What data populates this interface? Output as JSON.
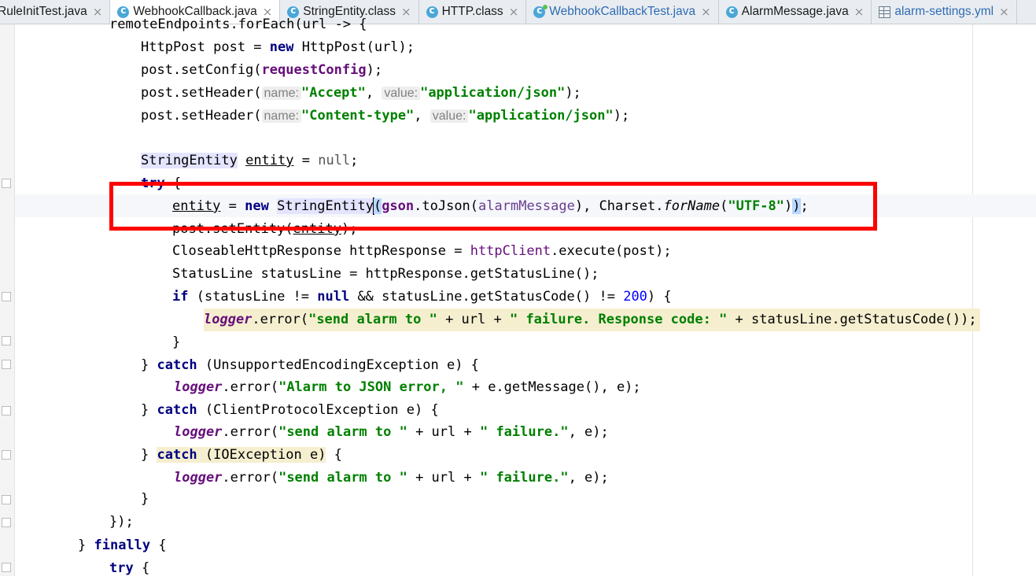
{
  "tabs": [
    {
      "label": "RuleInitTest.java",
      "icon": "java-class-icon"
    },
    {
      "label": "WebhookCallback.java",
      "icon": "java-class-icon",
      "active": true
    },
    {
      "label": "StringEntity.class",
      "icon": "compiled-class-icon"
    },
    {
      "label": "HTTP.class",
      "icon": "compiled-class-icon"
    },
    {
      "label": "WebhookCallbackTest.java",
      "icon": "java-test-class-icon"
    },
    {
      "label": "AlarmMessage.java",
      "icon": "java-class-icon"
    },
    {
      "label": "alarm-settings.yml",
      "icon": "yaml-file-icon"
    }
  ],
  "tab_close_glyph": "×",
  "colors": {
    "keyword": "#000080",
    "string": "#008000",
    "field": "#660e7a",
    "number": "#0000ff",
    "highlight_box": "#ff0000"
  },
  "code": {
    "l0_text": "remoteEndpoints.forEach(url -> {",
    "l1": {
      "a": "HttpPost post = ",
      "kw": "new",
      "b": " HttpPost(url);"
    },
    "l2": {
      "a": "post.setConfig(",
      "field": "requestConfig",
      "b": ");"
    },
    "l3": {
      "a": "post.setHeader(",
      "hint1": "name:",
      "s1": "\"Accept\"",
      "c": ", ",
      "hint2": "value:",
      "s2": "\"application/json\"",
      "b": ");"
    },
    "l4": {
      "a": "post.setHeader(",
      "hint1": "name:",
      "s1": "\"Content-type\"",
      "c": ", ",
      "hint2": "value:",
      "s2": "\"application/json\"",
      "b": ");"
    },
    "l5": {
      "type": "StringEntity",
      "sp": " ",
      "var": "entity",
      "eq": " = ",
      "kw": "null",
      "b": ";"
    },
    "l6": {
      "kw": "try",
      "b": " {"
    },
    "l7": {
      "var": "entity",
      "eq": " = ",
      "kw": "new",
      "sp": " ",
      "type": "StringEntity",
      "paren": "(",
      "field": "gson",
      "m": ".toJson(",
      "arg": "alarmMessage",
      "m2": "), Charset.",
      "smeth": "forName",
      "p2": "(",
      "str": "\"UTF-8\"",
      "p3": ")",
      "closeparen": ")",
      "b": ";"
    },
    "l8": {
      "a": "post.setEntity(",
      "var": "entity",
      "b": ");"
    },
    "l9": {
      "a": "CloseableHttpResponse httpResponse = ",
      "field": "httpClient",
      "b": ".execute(post);"
    },
    "l10": {
      "a": "StatusLine statusLine = httpResponse.getStatusLine();"
    },
    "l11": {
      "kw": "if",
      "a": " (statusLine != ",
      "kw2": "null",
      "b": " && statusLine.getStatusCode() != ",
      "num": "200",
      "c": ") {"
    },
    "l12": {
      "logger": "logger",
      "a": ".error(",
      "s1": "\"send alarm to \"",
      "b": " + url + ",
      "s2": "\" failure. Response code: \"",
      "c": " + statusLine.getStatusCode());"
    },
    "l13": {
      "a": "}"
    },
    "l14": {
      "a": "} ",
      "kw": "catch",
      "b": " (UnsupportedEncodingException e) {"
    },
    "l15": {
      "logger": "logger",
      "a": ".error(",
      "s1": "\"Alarm to JSON error, \"",
      "b": " + e.getMessage(), e);"
    },
    "l16": {
      "a": "} ",
      "kw": "catch",
      "b": " (ClientProtocolException e) {"
    },
    "l17": {
      "logger": "logger",
      "a": ".error(",
      "s1": "\"send alarm to \"",
      "b": " + url + ",
      "s2": "\" failure.\"",
      "c": ", e);"
    },
    "l18": {
      "a": "} ",
      "kw": "catch",
      "b": " (IOException e)",
      "c": " {"
    },
    "l19": {
      "logger": "logger",
      "a": ".error(",
      "s1": "\"send alarm to \"",
      "b": " + url + ",
      "s2": "\" failure.\"",
      "c": ", e);"
    },
    "l20": {
      "a": "}"
    },
    "l21": {
      "a": "});"
    },
    "l22": {
      "a": "} ",
      "kw": "finally",
      "b": " {"
    },
    "l23": {
      "kw": "try",
      "b": " {"
    }
  }
}
